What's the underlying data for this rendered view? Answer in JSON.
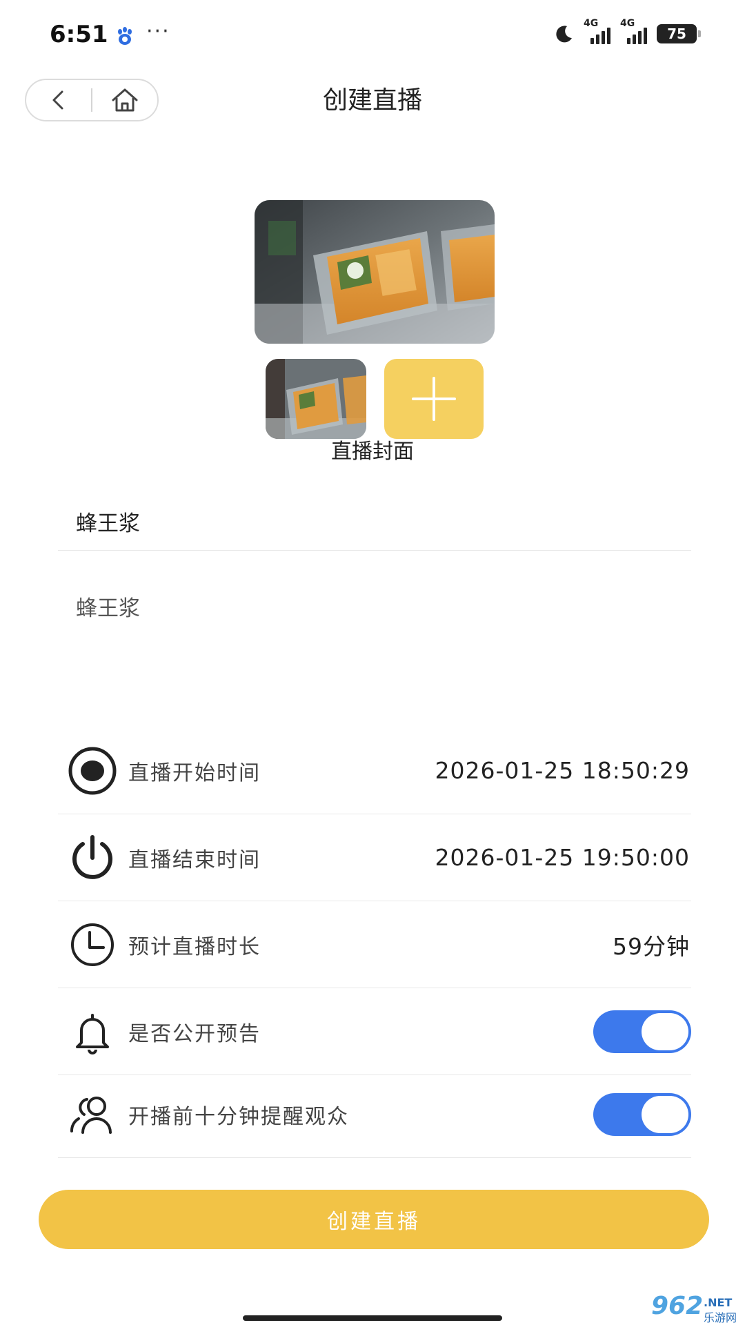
{
  "status_bar": {
    "time": "6:51",
    "dots": "···",
    "network_1": "4G",
    "network_2": "4G",
    "battery": "75"
  },
  "header": {
    "title": "创建直播",
    "back_icon": "chevron-left-icon",
    "home_icon": "home-icon"
  },
  "cover": {
    "label": "直播封面",
    "add_icon": "plus-icon"
  },
  "form": {
    "title_value": "蜂王浆",
    "description_value": "蜂王浆"
  },
  "settings": [
    {
      "icon": "record-icon",
      "label": "直播开始时间",
      "value": "2026-01-25 18:50:29"
    },
    {
      "icon": "power-icon",
      "label": "直播结束时间",
      "value": "2026-01-25 19:50:00"
    },
    {
      "icon": "clock-icon",
      "label": "预计直播时长",
      "value": "59分钟"
    },
    {
      "icon": "bell-icon",
      "label": "是否公开预告",
      "toggle": true
    },
    {
      "icon": "users-icon",
      "label": "开播前十分钟提醒观众",
      "toggle": true
    }
  ],
  "submit_label": "创建直播",
  "watermark": {
    "logo": "962",
    "domain": ".NET",
    "site": "乐游网"
  },
  "colors": {
    "accent_yellow": "#f2c346",
    "add_tile_yellow": "#f5d060",
    "toggle_blue": "#3d79ec"
  }
}
